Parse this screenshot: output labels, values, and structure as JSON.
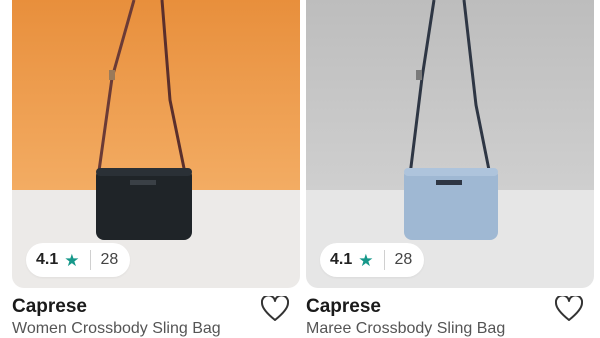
{
  "products": [
    {
      "brand": "Caprese",
      "name": "Women Crossbody Sling Bag",
      "rating": "4.1",
      "rating_icon": "star-icon",
      "reviews": "28",
      "wishlist_icon": "heart-outline-icon",
      "colors": {
        "background_top": "#ec9a49",
        "background_floor": "#eceae8",
        "bag": "#1f2428",
        "strap": "#6b3b36"
      }
    },
    {
      "brand": "Caprese",
      "name": "Maree Crossbody Sling Bag",
      "rating": "4.1",
      "rating_icon": "star-icon",
      "reviews": "28",
      "wishlist_icon": "heart-outline-icon",
      "colors": {
        "background_top": "#c4c4c4",
        "background_floor": "#e6e6e6",
        "bag": "#9fb8d3",
        "strap": "#2e3644"
      }
    }
  ],
  "colors": {
    "accent_star": "#16988a"
  }
}
